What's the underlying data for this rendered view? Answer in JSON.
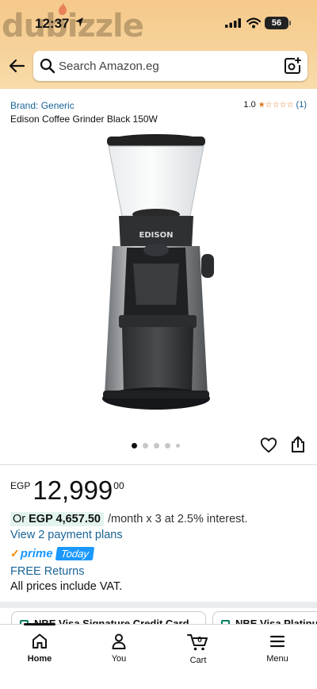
{
  "status_bar": {
    "time": "12:37",
    "battery": "56"
  },
  "watermark": "dubizzle",
  "search": {
    "placeholder": "Search Amazon.eg"
  },
  "product": {
    "brand_label": "Brand: Generic",
    "title": "Edison Coffee Grinder Black 150W",
    "image_brand_text": "EDISON",
    "rating": {
      "value": "1.0",
      "stars": "★☆☆☆☆",
      "count": "(1)",
      "score": 1,
      "max": 5
    },
    "images": {
      "total": 5,
      "active_index": 0
    }
  },
  "price": {
    "currency": "EGP",
    "whole": "12,999",
    "fraction": "00"
  },
  "installment": {
    "prefix": "Or",
    "amount": "EGP 4,657.50",
    "suffix": "/month x 3 at 2.5% interest."
  },
  "payment_plans_link": "View 2 payment plans",
  "prime": {
    "logo_text": "prime",
    "check": "✓",
    "badge": "Today"
  },
  "returns_link": "FREE Returns",
  "vat_note": "All prices include VAT.",
  "offer_cards": [
    {
      "label": "NBE Visa Signature Credit Card"
    },
    {
      "label": "NBE Visa Platinum"
    }
  ],
  "bottom_nav": {
    "items": [
      {
        "label": "Home",
        "icon": "home-icon",
        "active": true
      },
      {
        "label": "You",
        "icon": "person-icon",
        "active": false
      },
      {
        "label": "Cart",
        "icon": "cart-icon",
        "active": false,
        "count": "0"
      },
      {
        "label": "Menu",
        "icon": "menu-icon",
        "active": false
      }
    ]
  },
  "colors": {
    "link": "#1a6496",
    "star": "#de7921",
    "prime_blue": "#1a98ff",
    "header_bg": "#f6d29a"
  }
}
